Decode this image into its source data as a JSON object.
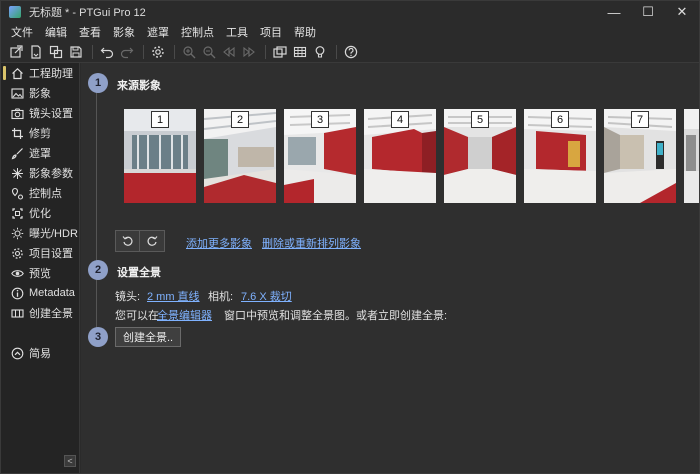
{
  "window": {
    "title": "无标题 * - PTGui Pro 12",
    "minimize_glyph": "—",
    "maximize_glyph": "☐",
    "close_glyph": "✕"
  },
  "menu": [
    "文件",
    "编辑",
    "查看",
    "影象",
    "遮罩",
    "控制点",
    "工具",
    "项目",
    "帮助"
  ],
  "toolbar": {
    "icons": [
      "new-project-icon",
      "open-icon",
      "duplicate-icon",
      "save-icon",
      "undo-icon",
      "redo-icon",
      "settings-icon",
      "zoom-in-icon",
      "zoom-out-icon",
      "previous-icon",
      "next-icon",
      "panorama-editor-icon",
      "grid-icon",
      "bulb-icon",
      "help-icon"
    ]
  },
  "sidebar": {
    "items": [
      {
        "label": "工程助理",
        "icon": "home-icon",
        "active": true
      },
      {
        "label": "影象",
        "icon": "image-icon"
      },
      {
        "label": "镜头设置",
        "icon": "camera-icon"
      },
      {
        "label": "修剪",
        "icon": "crop-icon"
      },
      {
        "label": "遮罩",
        "icon": "brush-icon"
      },
      {
        "label": "影象参数",
        "icon": "parameters-icon"
      },
      {
        "label": "控制点",
        "icon": "control-points-icon"
      },
      {
        "label": "优化",
        "icon": "optimize-icon"
      },
      {
        "label": "曝光/HDR",
        "icon": "exposure-icon"
      },
      {
        "label": "项目设置",
        "icon": "gear-icon"
      },
      {
        "label": "预览",
        "icon": "eye-icon"
      },
      {
        "label": "Metadata",
        "icon": "info-icon"
      },
      {
        "label": "创建全景",
        "icon": "panorama-icon"
      }
    ],
    "simple_label": "简易",
    "simple_icon": "chevron-up-circle-icon",
    "collapse_glyph": "<"
  },
  "steps": [
    {
      "number": "1",
      "title": "来源影象"
    },
    {
      "number": "2",
      "title": "设置全景"
    },
    {
      "number": "3",
      "title": ""
    }
  ],
  "images": [
    {
      "number": "1",
      "scene": "glass-entrance"
    },
    {
      "number": "2",
      "scene": "lobby"
    },
    {
      "number": "3",
      "scene": "red-wall"
    },
    {
      "number": "4",
      "scene": "red-wall"
    },
    {
      "number": "5",
      "scene": "red-corridor"
    },
    {
      "number": "6",
      "scene": "red-wall"
    },
    {
      "number": "7",
      "scene": "white-hall"
    }
  ],
  "actions": {
    "add_more_images": "添加更多影象",
    "remove_or_reorder": "删除或重新排列影象"
  },
  "setup": {
    "lens_label": "镜头:",
    "lens_value": "2 mm 直线",
    "camera_label": "相机:",
    "camera_value": "7.6 X 裁切",
    "hint_prefix": "您可以在",
    "hint_link": "全景编辑器",
    "hint_suffix": "窗口中预览和调整全景图。或者立即创建全景:"
  },
  "create_button": "创建全景..",
  "colors": {
    "accent_link": "#7fb2ff",
    "step_badge": "#8fa0c8",
    "active_marker": "#d9c36a",
    "background": "#2f2f2f"
  }
}
